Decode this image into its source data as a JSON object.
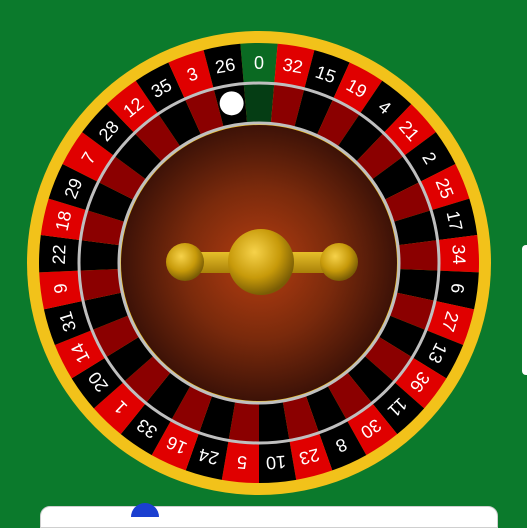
{
  "wheel": {
    "sequence": [
      "0",
      "32",
      "15",
      "19",
      "4",
      "21",
      "2",
      "25",
      "17",
      "34",
      "6",
      "27",
      "13",
      "36",
      "11",
      "30",
      "8",
      "23",
      "10",
      "5",
      "24",
      "16",
      "33",
      "1",
      "20",
      "14",
      "31",
      "9",
      "22",
      "18",
      "29",
      "7",
      "28",
      "12",
      "35",
      "3",
      "26"
    ],
    "pocket_colors": {
      "0": "green",
      "red": [
        "32",
        "19",
        "21",
        "25",
        "34",
        "27",
        "36",
        "30",
        "23",
        "5",
        "16",
        "1",
        "14",
        "9",
        "18",
        "7",
        "12",
        "3"
      ],
      "black": [
        "15",
        "4",
        "2",
        "17",
        "6",
        "13",
        "11",
        "8",
        "10",
        "24",
        "33",
        "20",
        "31",
        "22",
        "29",
        "28",
        "35",
        "26"
      ]
    },
    "ball_pocket": "26",
    "colors": {
      "felt": "#0b7a2c",
      "rim_gold": "#f2c21a",
      "red": "#e00000",
      "black": "#000000",
      "green": "#0a6a22",
      "inner_red": "#8b0000",
      "bowl": "#7a2a0c",
      "turret_gold": "#d1a10c"
    }
  }
}
